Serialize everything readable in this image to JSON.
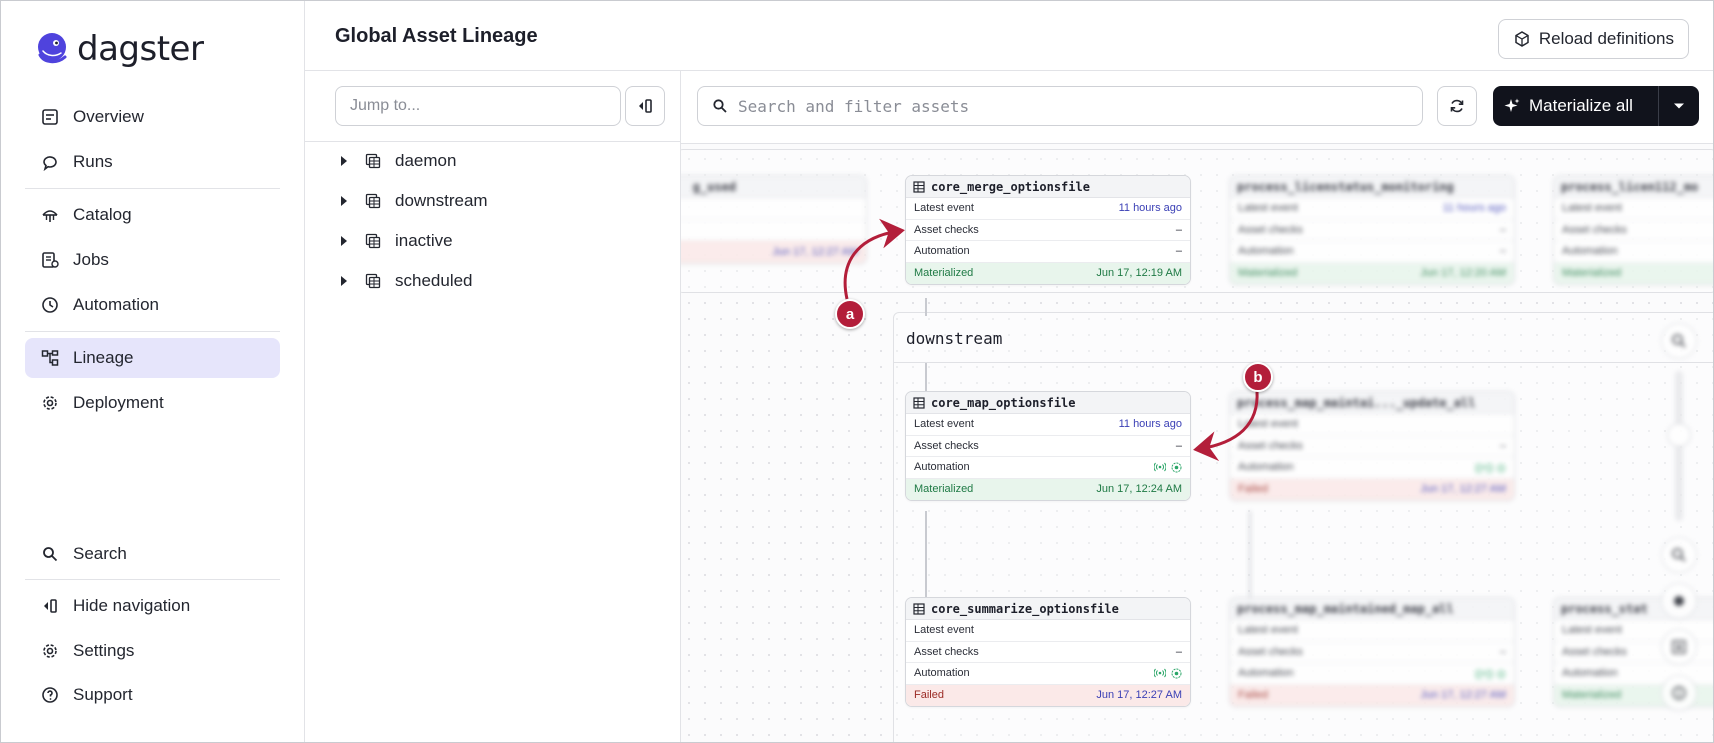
{
  "app": {
    "logo_text": "dagster"
  },
  "sidebar": {
    "items": [
      {
        "label": "Overview",
        "icon": "overview-icon"
      },
      {
        "label": "Runs",
        "icon": "runs-icon"
      },
      {
        "label": "Catalog",
        "icon": "catalog-icon"
      },
      {
        "label": "Jobs",
        "icon": "jobs-icon"
      },
      {
        "label": "Automation",
        "icon": "clock-icon"
      },
      {
        "label": "Lineage",
        "icon": "lineage-icon",
        "active": true
      },
      {
        "label": "Deployment",
        "icon": "gear-icon"
      }
    ],
    "bottom_items": [
      {
        "label": "Search",
        "icon": "search-icon"
      },
      {
        "label": "Hide navigation",
        "icon": "hide-nav-icon"
      },
      {
        "label": "Settings",
        "icon": "gear-icon"
      },
      {
        "label": "Support",
        "icon": "help-icon"
      }
    ]
  },
  "header": {
    "title": "Global Asset Lineage",
    "reload_label": "Reload definitions"
  },
  "tree": {
    "jump_placeholder": "Jump to...",
    "groups": [
      "daemon",
      "downstream",
      "inactive",
      "scheduled"
    ]
  },
  "graph": {
    "search_placeholder": "Search and filter assets",
    "materialize_label": "Materialize all",
    "group_label": "downstream",
    "row_labels": {
      "latest": "Latest event",
      "checks": "Asset checks",
      "automation": "Automation"
    },
    "cards": [
      {
        "name": "core_merge_optionsfile",
        "latest": "11 hours ago",
        "checks": "–",
        "automation": "–",
        "status": "Materialized",
        "status_time": "Jun 17, 12:19 AM"
      },
      {
        "name": "core_map_optionsfile",
        "latest": "11 hours ago",
        "checks": "–",
        "automation": "",
        "status": "Materialized",
        "status_time": "Jun 17, 12:24 AM"
      },
      {
        "name": "core_summarize_optionsfile",
        "latest": "",
        "checks": "–",
        "automation": "",
        "status": "Failed",
        "status_time": "Jun 17, 12:27 AM"
      }
    ],
    "blurred_cards": [
      {
        "name": "process_licenstatus_monitoring",
        "latest": "11 hours ago",
        "status": "Materialized",
        "status_time": "Jun 17, 12:20 AM"
      },
      {
        "name": "process_map_maintai..._update_all",
        "latest": "",
        "status": "Failed",
        "status_time": "Jun 17, 12:27 AM"
      },
      {
        "name": "process_map_maintained_map_all",
        "latest": "",
        "status": "Failed",
        "status_time": "Jun 17, 12:27 AM"
      },
      {
        "name": "process_licen112_mo",
        "latest": "",
        "status": "Materialized",
        "status_time": ""
      },
      {
        "name": "process_stat",
        "latest": "",
        "status": "Materialized",
        "status_time": ""
      },
      {
        "name": "g_used",
        "latest": "",
        "status": "",
        "status_time": "Jun 17, 12:27 AM"
      }
    ]
  },
  "callouts": {
    "a": "a",
    "b": "b"
  },
  "colors": {
    "accent": "#e6e5fb",
    "brand": "#4f43dd",
    "callout": "#b31e3a",
    "materialized": "#1f7a45",
    "failed": "#9b2b25"
  }
}
